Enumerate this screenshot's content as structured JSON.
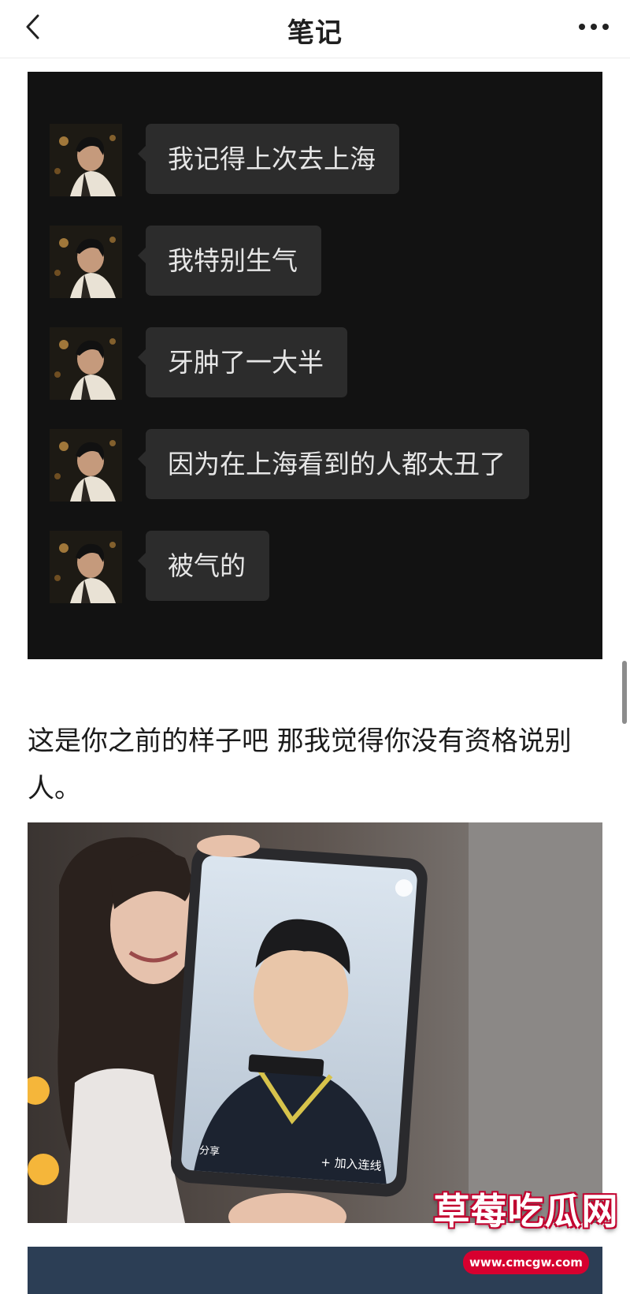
{
  "header": {
    "title": "笔记"
  },
  "chat": {
    "messages": [
      {
        "text": "我记得上次去上海"
      },
      {
        "text": "我特别生气"
      },
      {
        "text": "牙肿了一大半"
      },
      {
        "text": "因为在上海看到的人都太丑了"
      },
      {
        "text": "被气的"
      }
    ]
  },
  "caption": {
    "text": "这是你之前的样子吧 那我觉得你没有资格说别人。"
  },
  "photo": {
    "phone_overlay_button": "+ 加入连线",
    "phone_bottom_label": "分享"
  },
  "watermark": {
    "title": "草莓吃瓜网",
    "url": "www.cmcgw.com"
  },
  "colors": {
    "chat_bg": "#121212",
    "bubble_bg": "#2c2c2c",
    "bubble_text": "#e6e6e6",
    "watermark_red": "#d7002f"
  }
}
